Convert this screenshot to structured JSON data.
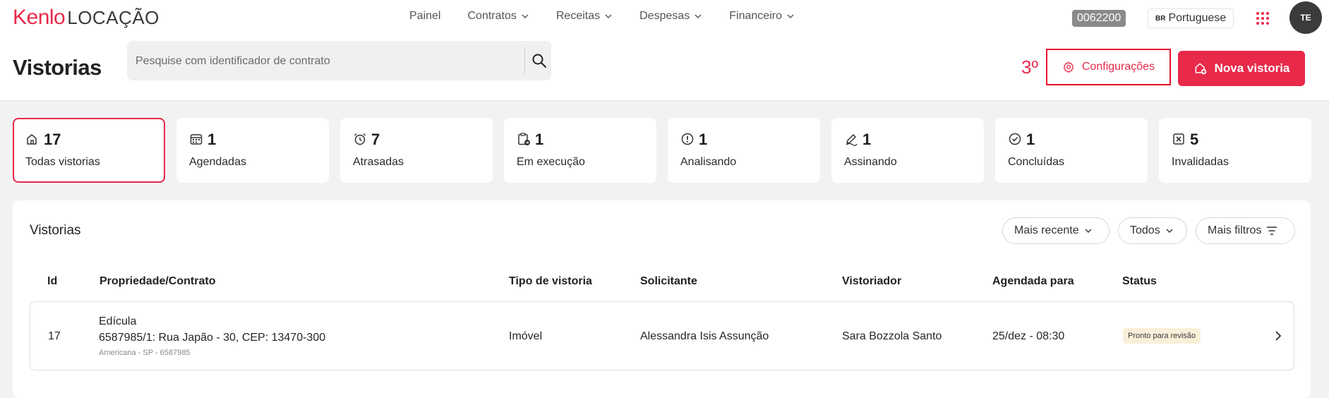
{
  "brand": {
    "logo_main": "Kenlo",
    "logo_sub": "LOCAÇÃO",
    "accent": "#e8294a"
  },
  "nav": {
    "items": [
      {
        "label": "Painel",
        "has_dropdown": false
      },
      {
        "label": "Contratos",
        "has_dropdown": true
      },
      {
        "label": "Receitas",
        "has_dropdown": true
      },
      {
        "label": "Despesas",
        "has_dropdown": true
      },
      {
        "label": "Financeiro",
        "has_dropdown": true
      }
    ]
  },
  "header": {
    "account_id": "0062200",
    "language": {
      "flag": "BR",
      "label": "Portuguese"
    },
    "avatar_initials": "TE",
    "apps_icon": "grid-dots-icon"
  },
  "page": {
    "title": "Vistorias",
    "search_placeholder": "Pesquise com identificador de contrato",
    "search_value": "",
    "step_label": "3º",
    "config_button": "Configurações",
    "new_button": "Nova vistoria"
  },
  "summary_cards": [
    {
      "count": "17",
      "label": "Todas vistorias",
      "icon": "houses-icon",
      "active": true
    },
    {
      "count": "1",
      "label": "Agendadas",
      "icon": "calendar-icon",
      "active": false
    },
    {
      "count": "7",
      "label": "Atrasadas",
      "icon": "alarm-clock-icon",
      "active": false
    },
    {
      "count": "1",
      "label": "Em execução",
      "icon": "clipboard-arrow-icon",
      "active": false
    },
    {
      "count": "1",
      "label": "Analisando",
      "icon": "alert-circle-icon",
      "active": false
    },
    {
      "count": "1",
      "label": "Assinando",
      "icon": "pen-icon",
      "active": false
    },
    {
      "count": "1",
      "label": "Concluídas",
      "icon": "check-circle-icon",
      "active": false
    },
    {
      "count": "5",
      "label": "Invalidadas",
      "icon": "x-square-icon",
      "active": false
    }
  ],
  "list": {
    "title": "Vistorias",
    "filters": {
      "sort": "Mais recente",
      "scope": "Todos",
      "more": "Mais filtros"
    },
    "columns": [
      "Id",
      "Propriedade/Contrato",
      "Tipo de vistoria",
      "Solicitante",
      "Vistoriador",
      "Agendada para",
      "Status"
    ],
    "rows": [
      {
        "id": "17",
        "property_name": "Edícula",
        "property_address": "6587985/1: Rua Japão - 30, CEP: 13470-300",
        "property_location": "Americana - SP - 6587985",
        "type": "Imóvel",
        "requester": "Alessandra Isis Assunção",
        "inspector": "Sara Bozzola Santo",
        "scheduled": "25/dez - 08:30",
        "status": "Pronto para revisão"
      }
    ]
  }
}
